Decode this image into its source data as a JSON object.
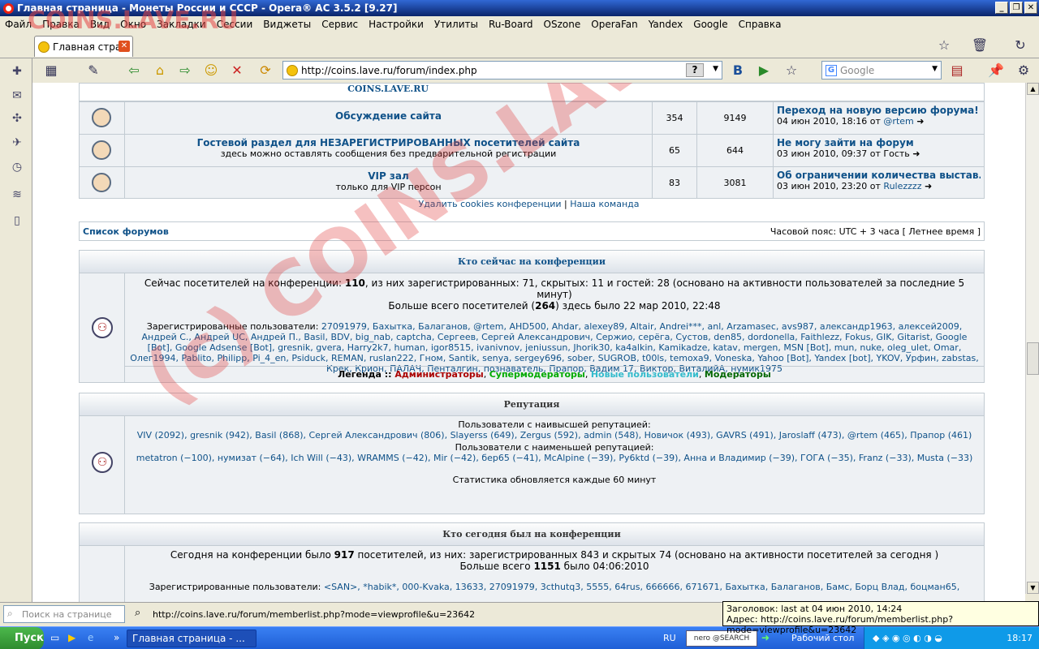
{
  "window": {
    "title": "Главная страница - Монеты России и СССР - Opera® AC 3.5.2 [9.27]"
  },
  "menu": [
    "Файл",
    "Правка",
    "Вид",
    "Окно",
    "Закладки",
    "Сессии",
    "Виджеты",
    "Сервис",
    "Настройки",
    "Утилиты",
    "Ru-Board",
    "OSzone",
    "OperaFan",
    "Yandex",
    "Google",
    "Справка"
  ],
  "tab": {
    "label": "Главная стра..."
  },
  "address": {
    "url": "http://coins.lave.ru/forum/index.php"
  },
  "search": {
    "placeholder": "Google"
  },
  "watermark": {
    "top": "COINS.LAVE.RU",
    "diagonal": "(c) COINS.LAVE.RU"
  },
  "forums": {
    "header": "COINS.LAVE.RU",
    "rows": [
      {
        "name": "Обсуждение сайта",
        "desc": "",
        "topics": "354",
        "posts": "9149",
        "last_title": "Переход на новую версию форума!",
        "last_date": "04 июн 2010, 18:16 от",
        "last_author": "@rtem"
      },
      {
        "name": "Гостевой раздел для НЕЗАРЕГИСТРИРОВАННЫХ посетителей сайта",
        "desc": "здесь можно оставлять сообщения без предварительной регистрации",
        "topics": "65",
        "posts": "644",
        "last_title": "Не могу зайти на форум",
        "last_date": "03 июн 2010, 09:37 от Гость",
        "last_author": ""
      },
      {
        "name": "VIP зал",
        "desc": "только для VIP персон",
        "topics": "83",
        "posts": "3081",
        "last_title": "Об ограничении количества выстав...",
        "last_date": "03 июн 2010, 23:20 от",
        "last_author": "Rulezzzz"
      }
    ],
    "footer_delete": "Удалить cookies конференции",
    "footer_sep": "|",
    "footer_team": "Наша команда"
  },
  "navrow": {
    "left": "Список форумов",
    "right": "Часовой пояс: UTC + 3 часа [ Летнее время ]"
  },
  "online": {
    "title": "Кто сейчас на конференции",
    "line1_a": "Сейчас посетителей на конференции: ",
    "line1_n": "110",
    "line1_b": ", из них зарегистрированных: 71, скрытых: 11 и гостей: 28 (основано на активности пользователей за последние 5 минут)",
    "line2_a": "Больше всего посетителей (",
    "line2_n": "264",
    "line2_b": ") здесь было 22 мар 2010, 22:48",
    "reg_label": "Зарегистрированные пользователи:",
    "users": "27091979, Бахытка, Балаганов, @rtem, AHD500, Ahdar, alexey89, Altair, Andrei***, anl, Arzamasec, avs987, александр1963, алексей2009, Андрей С., Андрей UC, Андрей П., Basil, BDV, big_nab, captcha, Сергеев, Сергей Александрович, Сержио, серёга, Сустов, den85, dordonella, Faithlezz, Fokus, GIK, Gitarist, Google [Bot], Google Adsense [Bot], gresnik, gvera, Harry2k7, human, igor8515, ivanivnov, jeniussun, Jhorik30, ka4alkin, Kamikadze, katav, mergen, MSN [Bot], mun, nuke, oleg_ulet, Omar, Олег1994, Pablito, Philipp, Pi_4_en, Psiduck, REMAN, ruslan222, Гном, Santik, senya, sergey696, sober, SUGROB, t00ls, temoxa9, Voneska, Yahoo [Bot], Yandex [bot], YKOV, Урфин, zabstas, Крек, Крион, ПАЛАЧ, Пенталгин, познаватель, Прапор, Вадим 17, Виктор, ВиталийА, нумик1975",
    "legend_label": "Легенда :: ",
    "legend": [
      "Администраторы",
      "Супермодераторы",
      "Новые пользователи",
      "Модераторы"
    ],
    "legend_colors": [
      "#aa0000",
      "#00aa00",
      "#33bbcc",
      "#006600"
    ]
  },
  "reputation": {
    "title": "Репутация",
    "high_label": "Пользователи с наивысшей репутацией:",
    "high": "VIV (2092), gresnik (942), Basil (868), Сергей Александрович (806), Slayerss (649), Zergus (592), admin (548), Новичок (493), GAVRS (491), Jaroslaff (473), @rtem (465), Прапор (461)",
    "low_label": "Пользователи с наименьшей репутацией:",
    "low": "metatron (−100), нумизат (−64), Ich Will (−43), WRAMMS (−42), Mir (−42), бер65 (−41), McAlpine (−39), Ру6ktd (−39), Анна и Владимир (−39), ГОГА (−35), Franz (−33), Musta (−33)",
    "refresh": "Статистика обновляется каждые 60 минут"
  },
  "today": {
    "title": "Кто сегодня был на конференции",
    "line1_a": "Сегодня на конференции было ",
    "line1_n": "917",
    "line1_b": " посетителей, из них: зарегистрированных 843 и скрытых 74 (основано на активности посетителей за сегодня )",
    "line2_a": "Больше всего ",
    "line2_n": "1151",
    "line2_b": " было 04:06:2010",
    "reg_label": "Зарегистрированные пользователи:",
    "users": "<SAN>, *habik*, 000-Kvaka, 13633, 27091979, 3cthutq3, 5555, 64rus, 666666, 671671, Бахытка, Балаганов, Бамс, Борц Влад, боцман65,"
  },
  "status": {
    "page_search": "Поиск на странице",
    "link": "http://coins.lave.ru/forum/memberlist.php?mode=viewprofile&u=23642"
  },
  "tooltip": {
    "line1": "Заголовок: last at 04 июн 2010, 14:24",
    "line2": "Адрес: http://coins.lave.ru/forum/memberlist.php?mode=viewprofile&u=23642"
  },
  "taskbar": {
    "start": "Пуск",
    "window": "Главная страница - ...",
    "lang": "RU",
    "nero": "nero @SEARCH",
    "desktop": "Рабочий стол",
    "clock": "18:17"
  }
}
